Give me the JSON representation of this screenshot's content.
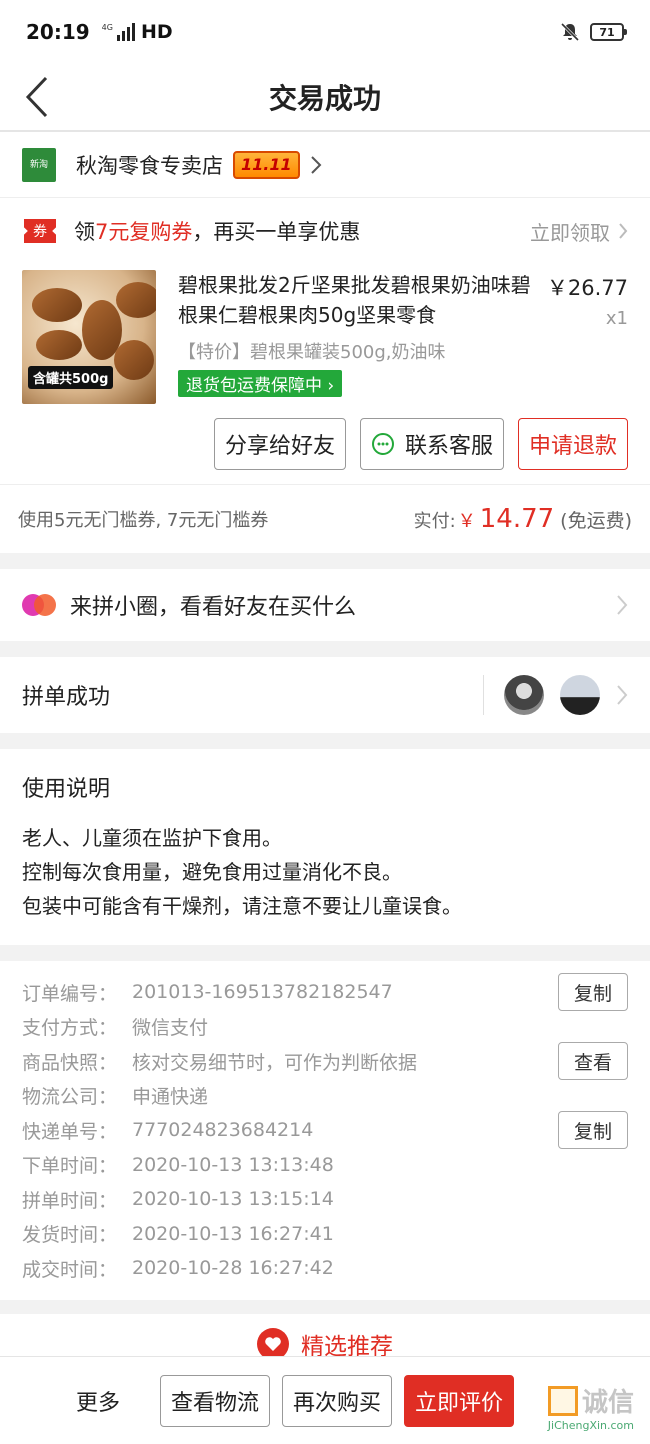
{
  "status_bar": {
    "time": "20:19",
    "network": "4G",
    "hd": "HD",
    "battery": "71"
  },
  "nav": {
    "title": "交易成功"
  },
  "shop": {
    "logo_text": "新淘",
    "name": "秋淘零食专卖店",
    "badge": "11.11"
  },
  "coupon": {
    "tag": "券",
    "text_prefix": "领",
    "text_highlight": "7元复购券",
    "text_suffix": "，再买一单享优惠",
    "link": "立即领取"
  },
  "product": {
    "image_label": "含罐共500g",
    "title": "碧根果批发2斤坚果批发碧根果奶油味碧根果仁碧根果肉50g坚果零食",
    "price": "￥26.77",
    "qty": "x1",
    "spec": "【特价】碧根果罐装500g,奶油味",
    "guarantee": "退货包运费保障中"
  },
  "actions": {
    "share": "分享给好友",
    "contact": "联系客服",
    "refund": "申请退款"
  },
  "payment": {
    "coupon_text": "使用5元无门槛券, 7元无门槛券",
    "label": "实付:",
    "currency": "￥",
    "amount": "14.77",
    "shipping": "(免运费)"
  },
  "circle": {
    "text": "来拼小圈，看看好友在买什么"
  },
  "group": {
    "text": "拼单成功"
  },
  "usage": {
    "title": "使用说明",
    "lines": [
      "老人、儿童须在监护下食用。",
      "控制每次食用量，避免食用过量消化不良。",
      "包装中可能含有干燥剂，请注意不要让儿童误食。"
    ]
  },
  "order_info": {
    "rows": [
      {
        "label": "订单编号：",
        "value": "201013-169513782182547",
        "button": "复制"
      },
      {
        "label": "支付方式：",
        "value": "微信支付"
      },
      {
        "label": "商品快照：",
        "value": "核对交易细节时，可作为判断依据",
        "button": "查看"
      },
      {
        "label": "物流公司：",
        "value": "申通快递"
      },
      {
        "label": "快递单号：",
        "value": "777024823684214",
        "button": "复制"
      },
      {
        "label": "下单时间：",
        "value": "2020-10-13 13:13:48"
      },
      {
        "label": "拼单时间：",
        "value": "2020-10-13 13:15:14"
      },
      {
        "label": "发货时间：",
        "value": "2020-10-13 16:27:41"
      },
      {
        "label": "成交时间：",
        "value": "2020-10-28 16:27:42"
      }
    ]
  },
  "recommend": {
    "text": "精选推荐"
  },
  "bottom_bar": {
    "more": "更多",
    "logistics": "查看物流",
    "rebuy": "再次购买",
    "review": "立即评价"
  },
  "watermark": {
    "cn": "诚信",
    "en": "JiChengXin.com"
  },
  "colors": {
    "accent": "#e02e24",
    "green": "#23a83a"
  }
}
